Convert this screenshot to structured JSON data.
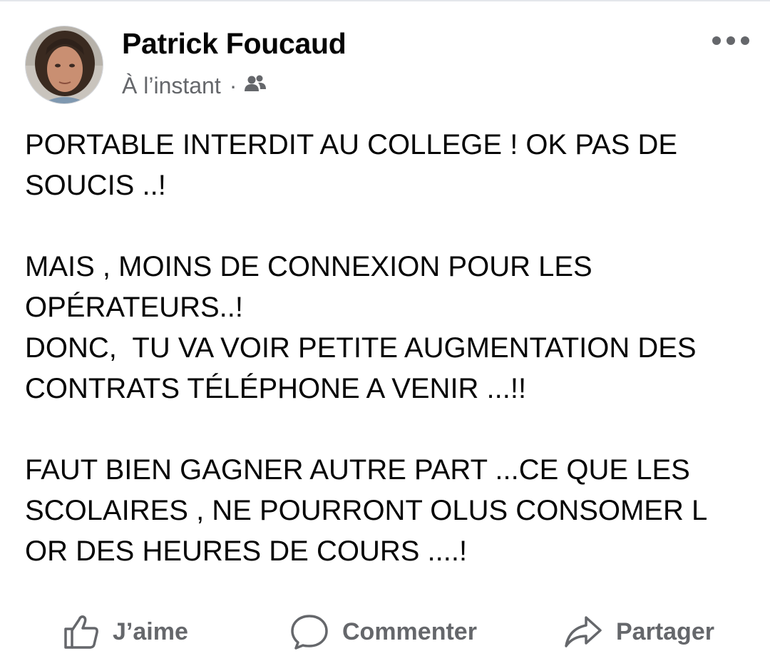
{
  "post": {
    "author": "Patrick Foucaud",
    "timestamp": "À l’instant",
    "separator": "·",
    "audience_icon": "friends-icon",
    "more_icon": "more-options-icon",
    "body": "PORTABLE INTERDIT AU COLLEGE ! OK PAS DE SOUCIS ..!\n\nMAIS , MOINS DE CONNEXION POUR LES OPÉRATEURS..!\nDONC,  TU VA VOIR PETITE AUGMENTATION DES CONTRATS TÉLÉPHONE A VENIR ...!!\n\nFAUT BIEN GAGNER AUTRE PART ...CE QUE LES SCOLAIRES , NE POURRONT OLUS CONSOMER L OR DES HEURES DE COURS ....!"
  },
  "actions": {
    "like": {
      "label": "J’aime",
      "icon": "thumbs-up-icon"
    },
    "comment": {
      "label": "Commenter",
      "icon": "comment-bubble-icon"
    },
    "share": {
      "label": "Partager",
      "icon": "share-arrow-icon"
    }
  },
  "colors": {
    "text": "#050505",
    "secondary_text": "#65676b",
    "background": "#ffffff"
  }
}
